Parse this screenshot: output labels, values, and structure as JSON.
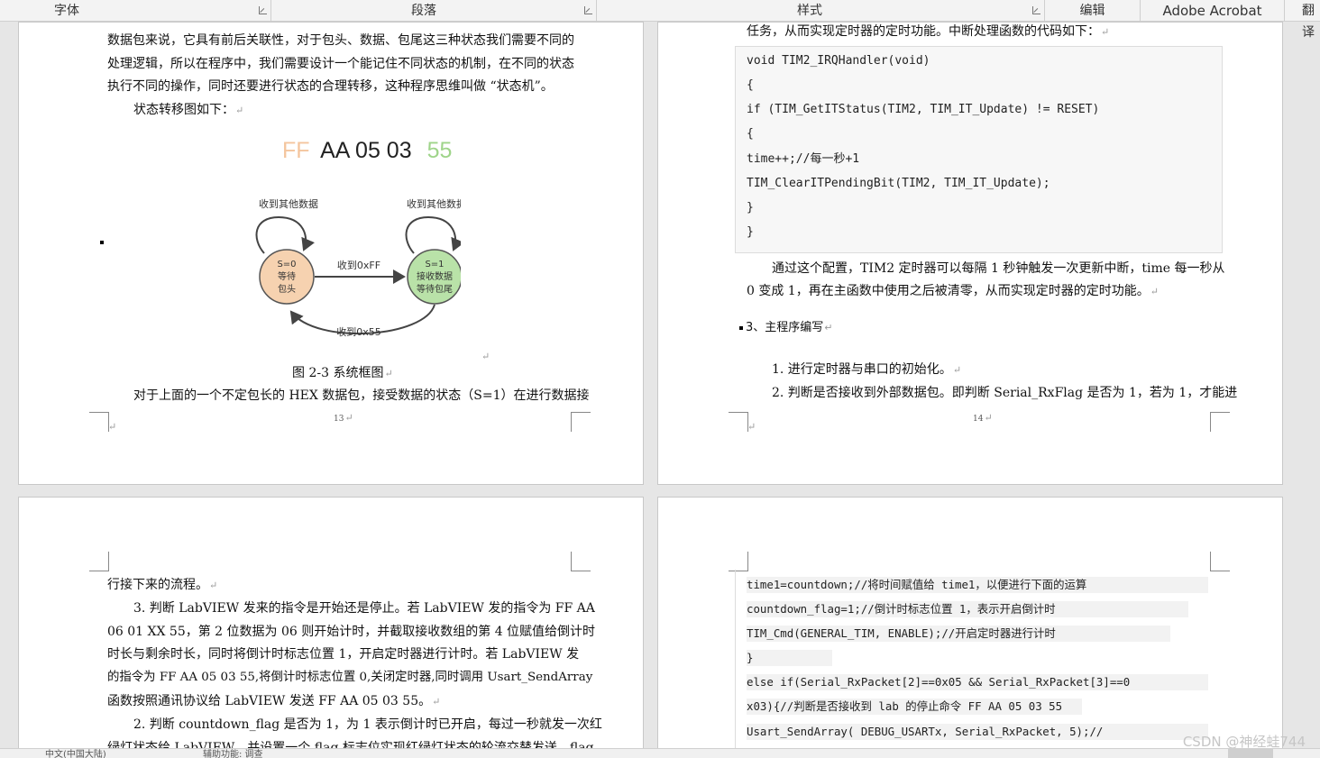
{
  "ribbon": {
    "groups": [
      "字体",
      "段落",
      "样式",
      "编辑",
      "Adobe Acrobat",
      "翻译"
    ]
  },
  "page13": {
    "lines": [
      "数据包来说，它具有前后关联性，对于包头、数据、包尾这三种状态我们需要不同的",
      "处理逻辑，所以在程序中，我们需要设计一个能记住不同状态的机制，在不同的状态",
      "执行不同的操作，同时还要进行状态的合理转移，这种程序思维叫做 “状态机”。",
      "状态转移图如下："
    ],
    "diagram": {
      "header": {
        "ff": "FF",
        "mid": "AA 05 03",
        "end": "55"
      },
      "loop_left": "收到其他数据",
      "loop_right": "收到其他数据",
      "state0": [
        "S=0",
        "等待",
        "包头"
      ],
      "state1": [
        "S=1",
        "接收数据",
        "等待包尾"
      ],
      "edge_top": "收到0xFF",
      "edge_bottom": "收到0x55",
      "colors": {
        "state0": "#f6d2b0",
        "state1": "#b9e2a8",
        "ff": "#f4c59e",
        "end": "#9fd48a"
      }
    },
    "caption": "图 2-3  系统框图",
    "last_line": "对于上面的一个不定包长的 HEX 数据包，接受数据的状态（S=1）在进行数据接",
    "page_number": "13"
  },
  "page14": {
    "intro": "任务，从而实现定时器的定时功能。中断处理函数的代码如下：",
    "code": [
      "void TIM2_IRQHandler(void)",
      "{",
      "    if (TIM_GetITStatus(TIM2, TIM_IT_Update) != RESET)",
      "    {",
      "        time++;//每一秒+1",
      "        TIM_ClearITPendingBit(TIM2, TIM_IT_Update);",
      "    }",
      "}"
    ],
    "para1": "通过这个配置，TIM2 定时器可以每隔 1 秒钟触发一次更新中断，time 每一秒从",
    "para2": "0 变成 1，再在主函数中使用之后被清零，从而实现定时器的定时功能。",
    "heading": "3、主程序编写",
    "item1": "1. 进行定时器与串口的初始化。",
    "item2": "2. 判断是否接收到外部数据包。即判断 Serial_RxFlag 是否为 1，若为 1，才能进",
    "page_number": "14"
  },
  "page15": {
    "lines": [
      "行接下来的流程。",
      "3. 判断 LabVIEW 发来的指令是开始还是停止。若 LabVIEW 发的指令为 FF AA",
      "06 01 XX 55，第 2 位数据为 06 则开始计时，并截取接收数组的第 4 位赋值给倒计时",
      "时长与剩余时长，同时将倒计时标志位置 1，开启定时器进行计时。若 LabVIEW 发",
      "的指令为 FF AA 05 03 55,将倒计时标志位置 0,关闭定时器,同时调用 Usart_SendArray",
      "函数按照通讯协议给 LabVIEW 发送 FF AA 05 03 55。",
      "2. 判断 countdown_flag 是否为 1，为 1 表示倒计时已开启，每过一秒就发一次红",
      "绿灯状态给 LabVIEW，并设置一个 flag 标志位实现红绿灯状态的轮流交替发送，flag"
    ]
  },
  "page16": {
    "code": [
      "            time1=countdown;//将时间赋值给 time1，以便进行下面的运算",
      "            countdown_flag=1;//倒计时标志位置 1，表示开启倒计时",
      "            TIM_Cmd(GENERAL_TIM, ENABLE);//开启定时器进行计时",
      "         }",
      "         else if(Serial_RxPacket[2]==0x05 && Serial_RxPacket[3]==0",
      "x03){//判断是否接收到 lab 的停止命令 FF AA 05 03 55",
      "            Usart_SendArray( DEBUG_USARTx, Serial_RxPacket, 5);//"
    ]
  },
  "status": {
    "items": [
      "中文(中国大陆)",
      "辅助功能: 调查"
    ]
  },
  "watermark": "CSDN @神经蛙744"
}
